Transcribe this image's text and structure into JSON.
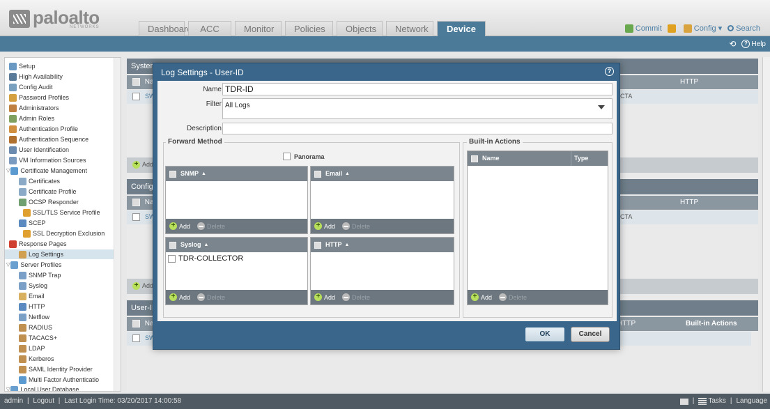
{
  "header": {
    "brand": "paloalto",
    "brand_sub": "NETWORKS",
    "tabs": [
      "Dashboard",
      "ACC",
      "Monitor",
      "Policies",
      "Objects",
      "Network",
      "Device"
    ],
    "actions": {
      "commit": "Commit",
      "config": "Config ▾",
      "search": "Search"
    },
    "help": "Help"
  },
  "sidebar": {
    "items": [
      "Setup",
      "High Availability",
      "Config Audit",
      "Password Profiles",
      "Administrators",
      "Admin Roles",
      "Authentication Profile",
      "Authentication Sequence",
      "User Identification",
      "VM Information Sources",
      "Certificate Management",
      "Certificates",
      "Certificate Profile",
      "OCSP Responder",
      "SSL/TLS Service Profile",
      "SCEP",
      "SSL Decryption Exclusion",
      "Response Pages",
      "Log Settings",
      "Server Profiles",
      "SNMP Trap",
      "Syslog",
      "Email",
      "HTTP",
      "Netflow",
      "RADIUS",
      "TACACS+",
      "LDAP",
      "Kerberos",
      "SAML Identity Provider",
      "Multi Factor Authenticatio",
      "Local User Database"
    ]
  },
  "background": {
    "system_title": "System",
    "config_title": "Configu",
    "userid_title": "User-ID",
    "name_col": "Na",
    "http_col": "HTTP",
    "builtin_col": "Built-in Actions",
    "row_value": "CTA",
    "row_prefix": "SW",
    "add": "Add"
  },
  "modal": {
    "title": "Log Settings - User-ID",
    "name_label": "Name",
    "name_value": "TDR-ID",
    "filter_label": "Filter",
    "filter_value": "All Logs",
    "description_label": "Description",
    "description_value": "",
    "forward_method": "Forward Method",
    "panorama": "Panorama",
    "builtin_actions": "Built-in Actions",
    "builtin_cols": [
      "Name",
      "Type"
    ],
    "panels": {
      "snmp": "SNMP",
      "email": "Email",
      "syslog": "Syslog",
      "http": "HTTP"
    },
    "syslog_item": "TDR-COLLECTOR",
    "add": "Add",
    "delete": "Delete",
    "ok": "OK",
    "cancel": "Cancel"
  },
  "statusbar": {
    "user": "admin",
    "logout": "Logout",
    "last_login": "Last Login Time: 03/20/2017 14:00:58",
    "tasks": "Tasks",
    "language": "Language"
  }
}
